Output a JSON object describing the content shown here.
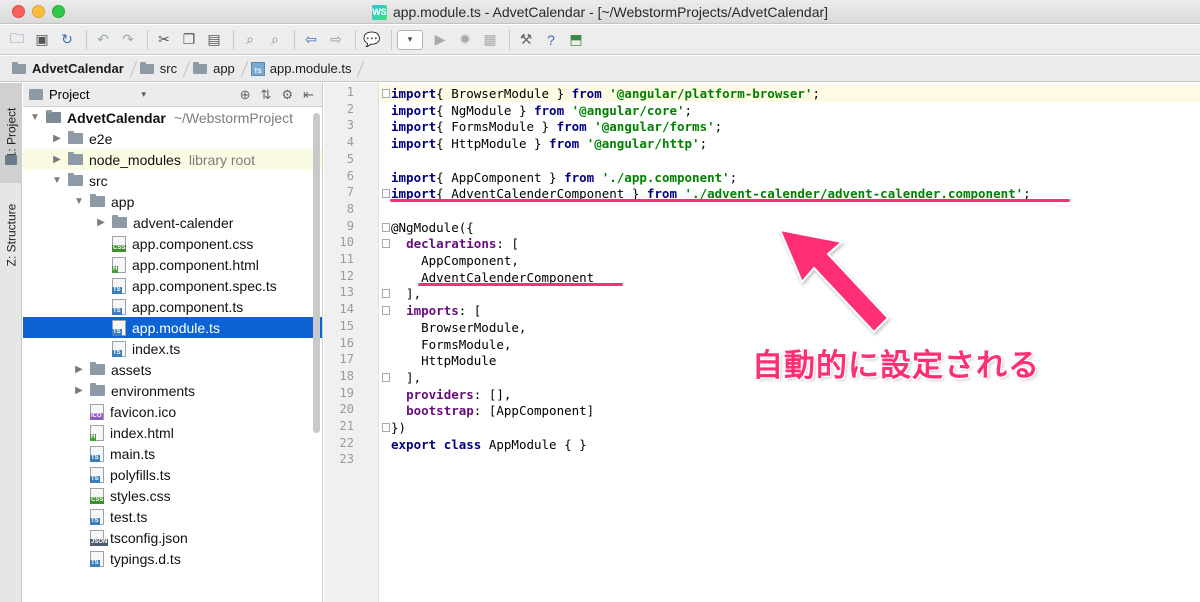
{
  "window": {
    "title": "app.module.ts - AdvetCalendar - [~/WebstormProjects/AdvetCalendar]",
    "logo_text": "WS"
  },
  "toolbar": {
    "icons": [
      "open-folder-icon",
      "save-icon",
      "sync-icon",
      "undo-icon",
      "redo-icon",
      "cut-icon",
      "copy-icon",
      "paste-icon",
      "find-icon",
      "replace-icon",
      "back-icon",
      "forward-icon",
      "comment-icon",
      "run-config-dropdown",
      "run-icon",
      "debug-icon",
      "coverage-icon",
      "settings-icon",
      "help-icon",
      "vcs-icon"
    ],
    "run_config_caret": "▾"
  },
  "breadcrumb": {
    "items": [
      "AdvetCalendar",
      "src",
      "app",
      "app.module.ts"
    ]
  },
  "tool_windows": {
    "project_tab": "1: Project",
    "structure_tab": "Z: Structure"
  },
  "project_panel": {
    "title": "Project",
    "caret": "▾",
    "action_icons": [
      "⊕",
      "⇅",
      "⚙",
      "⇤"
    ]
  },
  "tree": [
    {
      "label": "AdvetCalendar",
      "hint": "~/WebstormProject",
      "type": "module",
      "depth": 0,
      "expanded": true
    },
    {
      "label": "e2e",
      "type": "folder",
      "depth": 1,
      "expanded": false
    },
    {
      "label": "node_modules",
      "hint": "library root",
      "type": "folder",
      "depth": 1,
      "expanded": false,
      "excluded": true
    },
    {
      "label": "src",
      "type": "folder",
      "depth": 1,
      "expanded": true
    },
    {
      "label": "app",
      "type": "folder",
      "depth": 2,
      "expanded": true
    },
    {
      "label": "advent-calender",
      "type": "folder",
      "depth": 3,
      "expanded": false
    },
    {
      "label": "app.component.css",
      "type": "file",
      "badge": "css",
      "depth": 3
    },
    {
      "label": "app.component.html",
      "type": "file",
      "badge": "html",
      "depth": 3
    },
    {
      "label": "app.component.spec.ts",
      "type": "file",
      "badge": "ts",
      "depth": 3
    },
    {
      "label": "app.component.ts",
      "type": "file",
      "badge": "ts",
      "depth": 3
    },
    {
      "label": "app.module.ts",
      "type": "file",
      "badge": "ts",
      "depth": 3,
      "selected": true
    },
    {
      "label": "index.ts",
      "type": "file",
      "badge": "ts",
      "depth": 3
    },
    {
      "label": "assets",
      "type": "folder",
      "depth": 2,
      "expanded": false
    },
    {
      "label": "environments",
      "type": "folder",
      "depth": 2,
      "expanded": false
    },
    {
      "label": "favicon.ico",
      "type": "file",
      "badge": "ico",
      "depth": 2
    },
    {
      "label": "index.html",
      "type": "file",
      "badge": "html",
      "depth": 2
    },
    {
      "label": "main.ts",
      "type": "file",
      "badge": "ts",
      "depth": 2
    },
    {
      "label": "polyfills.ts",
      "type": "file",
      "badge": "ts",
      "depth": 2
    },
    {
      "label": "styles.css",
      "type": "file",
      "badge": "css",
      "depth": 2
    },
    {
      "label": "test.ts",
      "type": "file",
      "badge": "ts",
      "depth": 2
    },
    {
      "label": "tsconfig.json",
      "type": "file",
      "badge": "json",
      "depth": 2
    },
    {
      "label": "typings.d.ts",
      "type": "file",
      "badge": "ts",
      "depth": 2
    }
  ],
  "badge_text": {
    "ts": "TS",
    "css": "CSS",
    "html": "H",
    "json": "JSON",
    "ico": "ICO"
  },
  "code": [
    [
      [
        "kw",
        "import"
      ],
      [
        "",
        "{ BrowserModule } "
      ],
      [
        "kw",
        "from"
      ],
      [
        "",
        " "
      ],
      [
        "str",
        "'@angular/platform-browser'"
      ],
      [
        "",
        ";"
      ]
    ],
    [
      [
        "kw",
        "import"
      ],
      [
        "",
        "{ NgModule } "
      ],
      [
        "kw",
        "from"
      ],
      [
        "",
        " "
      ],
      [
        "str",
        "'@angular/core'"
      ],
      [
        "",
        ";"
      ]
    ],
    [
      [
        "kw",
        "import"
      ],
      [
        "",
        "{ FormsModule } "
      ],
      [
        "kw",
        "from"
      ],
      [
        "",
        " "
      ],
      [
        "str",
        "'@angular/forms'"
      ],
      [
        "",
        ";"
      ]
    ],
    [
      [
        "kw",
        "import"
      ],
      [
        "",
        "{ HttpModule } "
      ],
      [
        "kw",
        "from"
      ],
      [
        "",
        " "
      ],
      [
        "str",
        "'@angular/http'"
      ],
      [
        "",
        ";"
      ]
    ],
    [],
    [
      [
        "kw",
        "import"
      ],
      [
        "",
        "{ AppComponent } "
      ],
      [
        "kw",
        "from"
      ],
      [
        "",
        " "
      ],
      [
        "str",
        "'./app.component'"
      ],
      [
        "",
        ";"
      ]
    ],
    [
      [
        "kw",
        "import"
      ],
      [
        "",
        "{ AdventCalenderComponent } "
      ],
      [
        "kw",
        "from"
      ],
      [
        "",
        " "
      ],
      [
        "str",
        "'./advent-calender/advent-calender.component'"
      ],
      [
        "",
        ";"
      ]
    ],
    [],
    [
      [
        "",
        "@NgModule({"
      ]
    ],
    [
      [
        "",
        "  "
      ],
      [
        "prop",
        "declarations"
      ],
      [
        "",
        ": ["
      ]
    ],
    [
      [
        "",
        "    AppComponent,"
      ]
    ],
    [
      [
        "",
        "    AdventCalenderComponent"
      ]
    ],
    [
      [
        "",
        "  ],"
      ]
    ],
    [
      [
        "",
        "  "
      ],
      [
        "prop",
        "imports"
      ],
      [
        "",
        ": ["
      ]
    ],
    [
      [
        "",
        "    BrowserModule,"
      ]
    ],
    [
      [
        "",
        "    FormsModule,"
      ]
    ],
    [
      [
        "",
        "    HttpModule"
      ]
    ],
    [
      [
        "",
        "  ],"
      ]
    ],
    [
      [
        "",
        "  "
      ],
      [
        "prop",
        "providers"
      ],
      [
        "",
        ": [],"
      ]
    ],
    [
      [
        "",
        "  "
      ],
      [
        "prop",
        "bootstrap"
      ],
      [
        "",
        ": [AppComponent]"
      ]
    ],
    [
      [
        "",
        "})"
      ]
    ],
    [
      [
        "kw",
        "export"
      ],
      [
        "",
        " "
      ],
      [
        "kw",
        "class"
      ],
      [
        "",
        " AppModule { }"
      ]
    ],
    []
  ],
  "annotation": {
    "text": "自動的に設定される",
    "color": "#ff2f76"
  }
}
